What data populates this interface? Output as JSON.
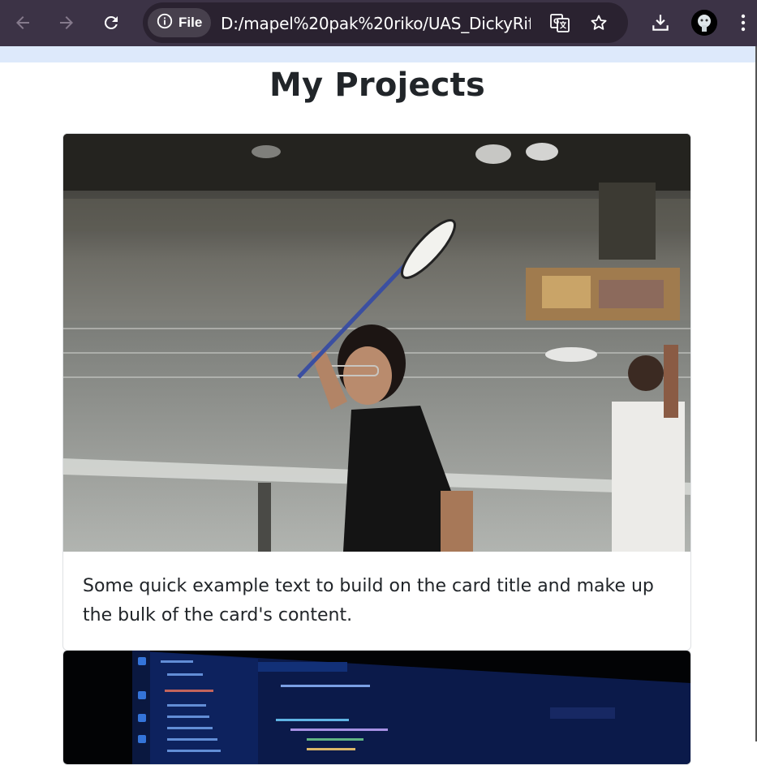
{
  "browser": {
    "chip_label": "File",
    "url": "D:/mapel%20pak%20riko/UAS_DickyRif...",
    "icons": {
      "back": "arrow-left-icon",
      "forward": "arrow-right-icon",
      "reload": "reload-icon",
      "info": "info-icon",
      "translate": "translate-icon",
      "bookmark": "star-icon",
      "download": "download-icon",
      "menu": "kebab-menu-icon"
    }
  },
  "page": {
    "title": "My Projects"
  },
  "cards": [
    {
      "image": "badminton-players-photo",
      "text": "Some quick example text to build on the card title and make up the bulk of the card's content."
    },
    {
      "image": "code-editor-laptop-photo"
    }
  ],
  "colors": {
    "chrome_bg": "#3c3346",
    "omnibox_bg": "#2a2230",
    "accent_strip": "#dde9fb",
    "text": "#212529"
  }
}
